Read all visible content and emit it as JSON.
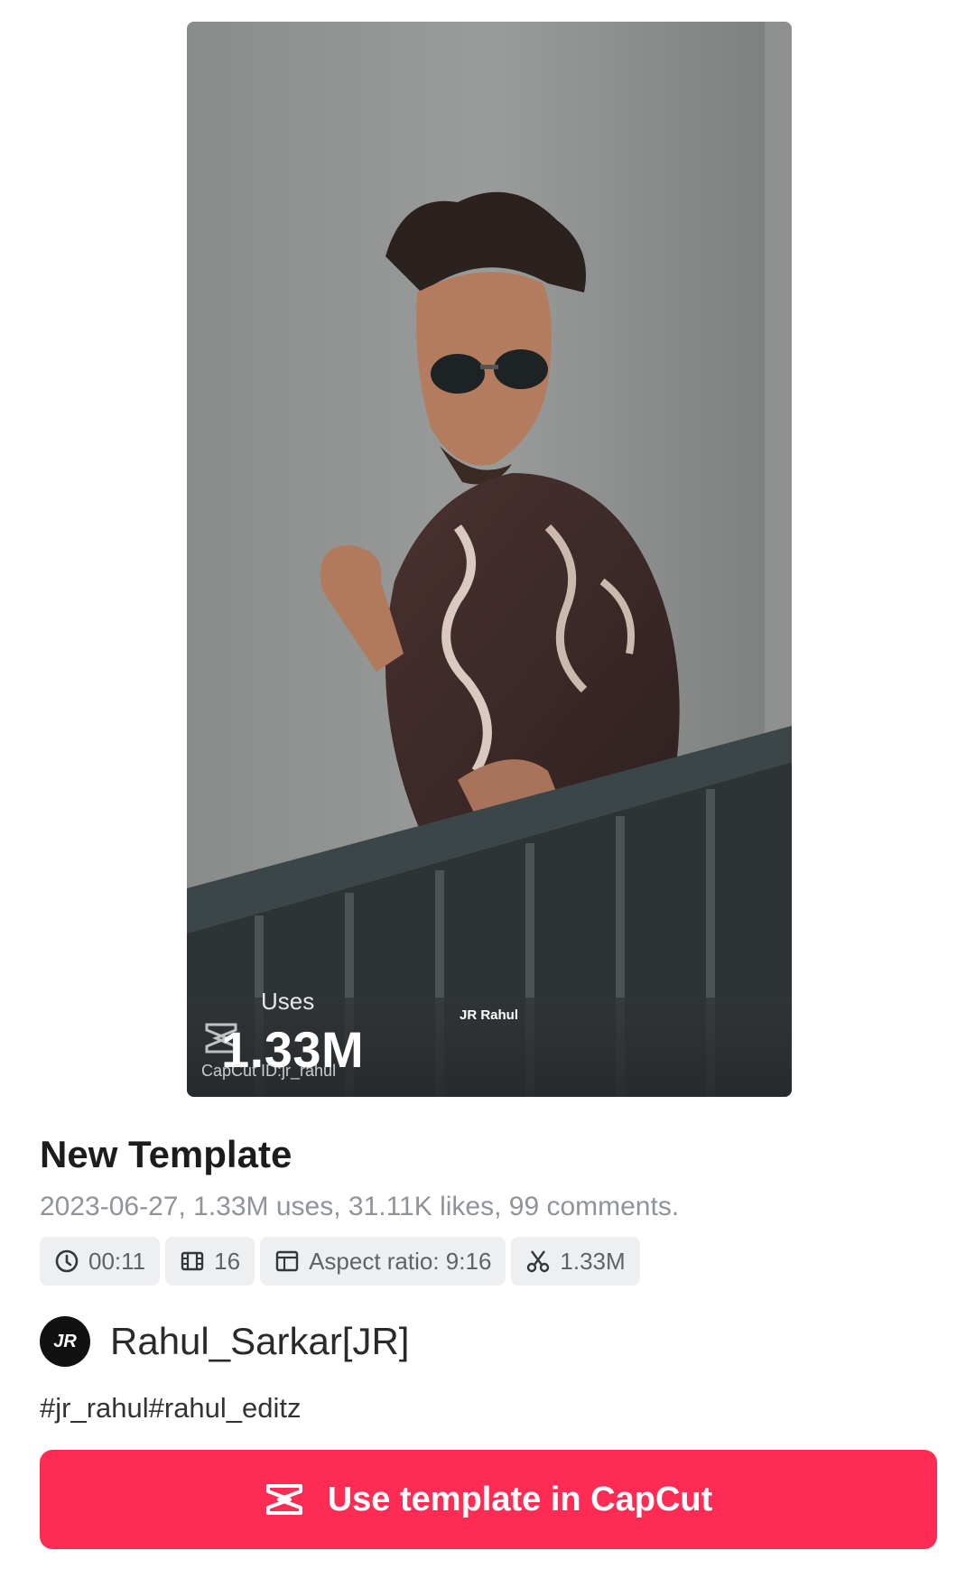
{
  "preview": {
    "uses_label": "Uses",
    "uses_value": "1.33M",
    "watermark_id": "CapCut ID:jr_rahul",
    "creator_tag": "JR Rahul"
  },
  "template": {
    "title": "New Template",
    "meta": "2023-06-27, 1.33M uses, 31.11K likes, 99 comments."
  },
  "chips": {
    "duration": "00:11",
    "clips": "16",
    "aspect": "Aspect ratio: 9:16",
    "uses": "1.33M"
  },
  "author": {
    "avatar_text": "JR",
    "name": "Rahul_Sarkar[JR]"
  },
  "hashtags": "#jr_rahul#rahul_editz",
  "cta": {
    "label": "Use template in CapCut"
  },
  "colors": {
    "brand": "#fe2c55",
    "chip_bg": "#eeeff1",
    "meta_text": "#8f949b"
  },
  "icons": [
    "clock-icon",
    "film-icon",
    "aspect-ratio-icon",
    "scissors-icon",
    "capcut-logo-icon"
  ]
}
